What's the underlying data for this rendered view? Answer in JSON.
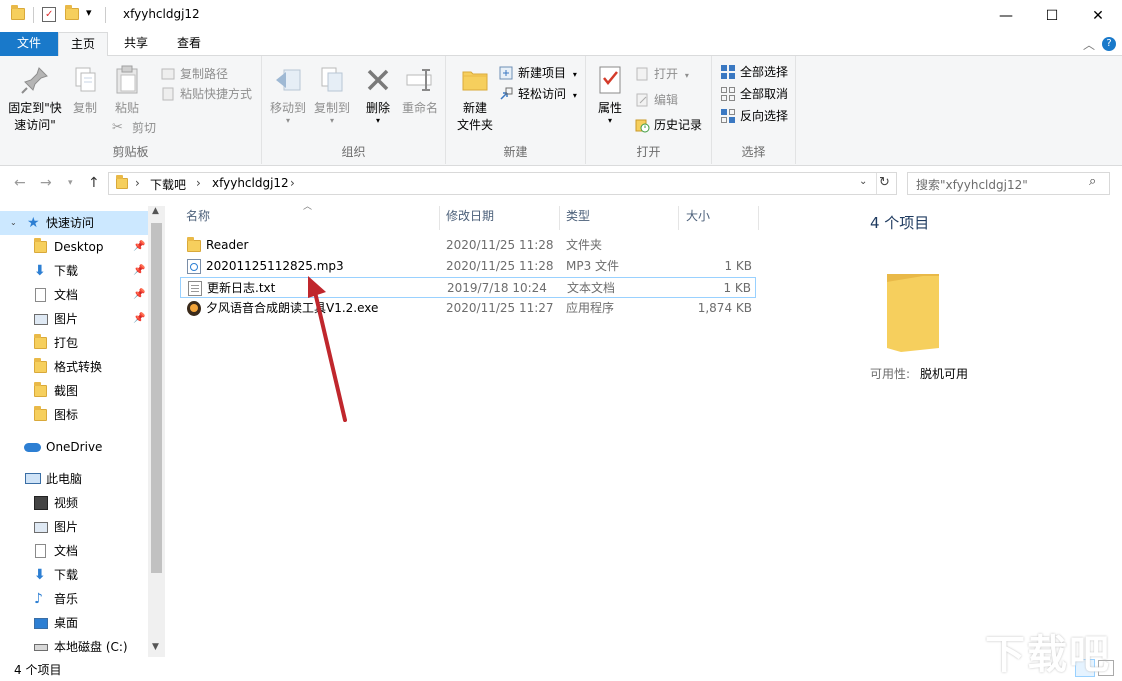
{
  "window": {
    "title": "xfyyhcldgj12",
    "quick_access_dropdown": "▾",
    "minimize": "—",
    "maximize": "☐",
    "close": "✕"
  },
  "tabs": {
    "file": "文件",
    "home": "主页",
    "share": "共享",
    "view": "查看"
  },
  "ribbon": {
    "clipboard": {
      "label": "剪贴板",
      "pin_line1": "固定到\"快",
      "pin_line2": "速访问\"",
      "copy": "复制",
      "paste": "粘贴",
      "copy_path": "复制路径",
      "paste_shortcut": "粘贴快捷方式",
      "cut": "剪切"
    },
    "organize": {
      "label": "组织",
      "move_to": "移动到",
      "copy_to": "复制到",
      "delete": "删除",
      "rename": "重命名"
    },
    "new": {
      "label": "新建",
      "new_folder_line1": "新建",
      "new_folder_line2": "文件夹",
      "new_item": "新建项目",
      "easy_access": "轻松访问"
    },
    "open": {
      "label": "打开",
      "properties": "属性",
      "open": "打开",
      "edit": "编辑",
      "history": "历史记录"
    },
    "select": {
      "label": "选择",
      "select_all": "全部选择",
      "select_none": "全部取消",
      "invert": "反向选择"
    }
  },
  "address": {
    "segments": [
      "下载吧",
      "xfyyhcldgj12"
    ],
    "separator": "›",
    "search_placeholder": "搜索\"xfyyhcldgj12\""
  },
  "nav_pane": {
    "quick_access": "快速访问",
    "quick_items": [
      "Desktop",
      "下载",
      "文档",
      "图片",
      "打包",
      "格式转换",
      "截图",
      "图标"
    ],
    "onedrive": "OneDrive",
    "this_pc": "此电脑",
    "pc_items": [
      "视频",
      "图片",
      "文档",
      "下载",
      "音乐",
      "桌面",
      "本地磁盘 (C:)"
    ]
  },
  "columns": {
    "name": "名称",
    "date": "修改日期",
    "type": "类型",
    "size": "大小"
  },
  "files": [
    {
      "name": "Reader",
      "date": "2020/11/25 11:28",
      "type": "文件夹",
      "size": ""
    },
    {
      "name": "20201125112825.mp3",
      "date": "2020/11/25 11:28",
      "type": "MP3 文件",
      "size": "1 KB"
    },
    {
      "name": "更新日志.txt",
      "date": "2019/7/18 10:24",
      "type": "文本文档",
      "size": "1 KB"
    },
    {
      "name": "夕风语音合成朗读工具V1.2.exe",
      "date": "2020/11/25 11:27",
      "type": "应用程序",
      "size": "1,874 KB"
    }
  ],
  "details": {
    "count": "4 个项目",
    "availability_label": "可用性:",
    "availability_value": "脱机可用"
  },
  "status": {
    "count": "4 个项目"
  },
  "watermark": "下载吧",
  "colors": {
    "accent": "#1979ca",
    "folder": "#f6cf5d",
    "selection_border": "#99d1ff",
    "arrow": "#c0272d"
  }
}
